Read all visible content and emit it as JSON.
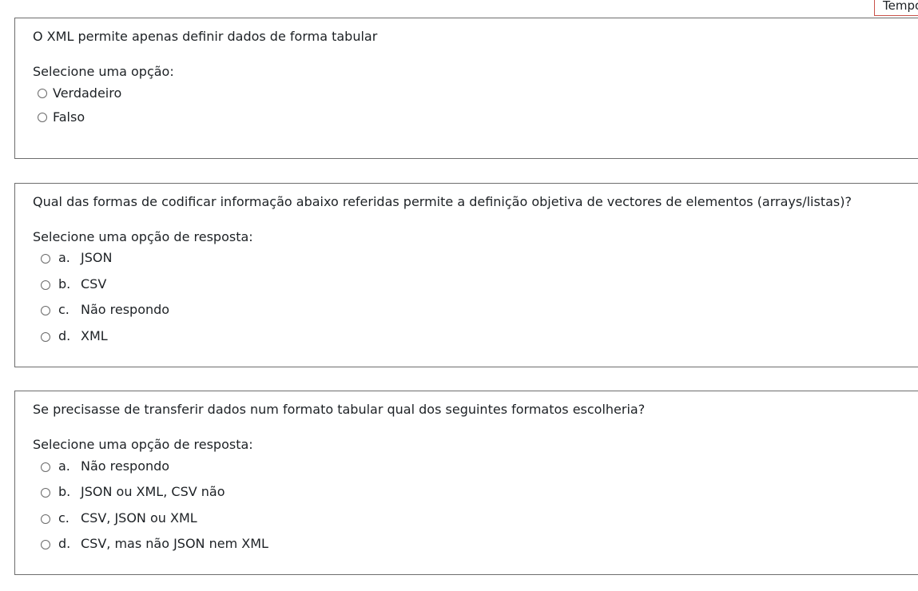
{
  "timer": {
    "label": "Tempo"
  },
  "questions": [
    {
      "text": "O XML permite apenas definir dados de forma tabular",
      "prompt": "Selecione uma opção:",
      "options": [
        {
          "label": "Verdadeiro"
        },
        {
          "label": "Falso"
        }
      ]
    },
    {
      "text": "Qual das formas de codificar informação abaixo referidas permite a definição objetiva de vectores de elementos (arrays/listas)?",
      "prompt": "Selecione uma opção de resposta:",
      "options": [
        {
          "letter": "a.",
          "label": "JSON"
        },
        {
          "letter": "b.",
          "label": "CSV"
        },
        {
          "letter": "c.",
          "label": "Não respondo"
        },
        {
          "letter": "d.",
          "label": "XML"
        }
      ]
    },
    {
      "text": "Se precisasse de transferir dados num formato tabular qual dos seguintes formatos escolheria?",
      "prompt": "Selecione uma opção de resposta:",
      "options": [
        {
          "letter": "a.",
          "label": "Não respondo"
        },
        {
          "letter": "b.",
          "label": "JSON ou XML, CSV não"
        },
        {
          "letter": "c.",
          "label": "CSV, JSON ou XML"
        },
        {
          "letter": "d.",
          "label": "CSV, mas não JSON nem XML"
        }
      ]
    }
  ]
}
